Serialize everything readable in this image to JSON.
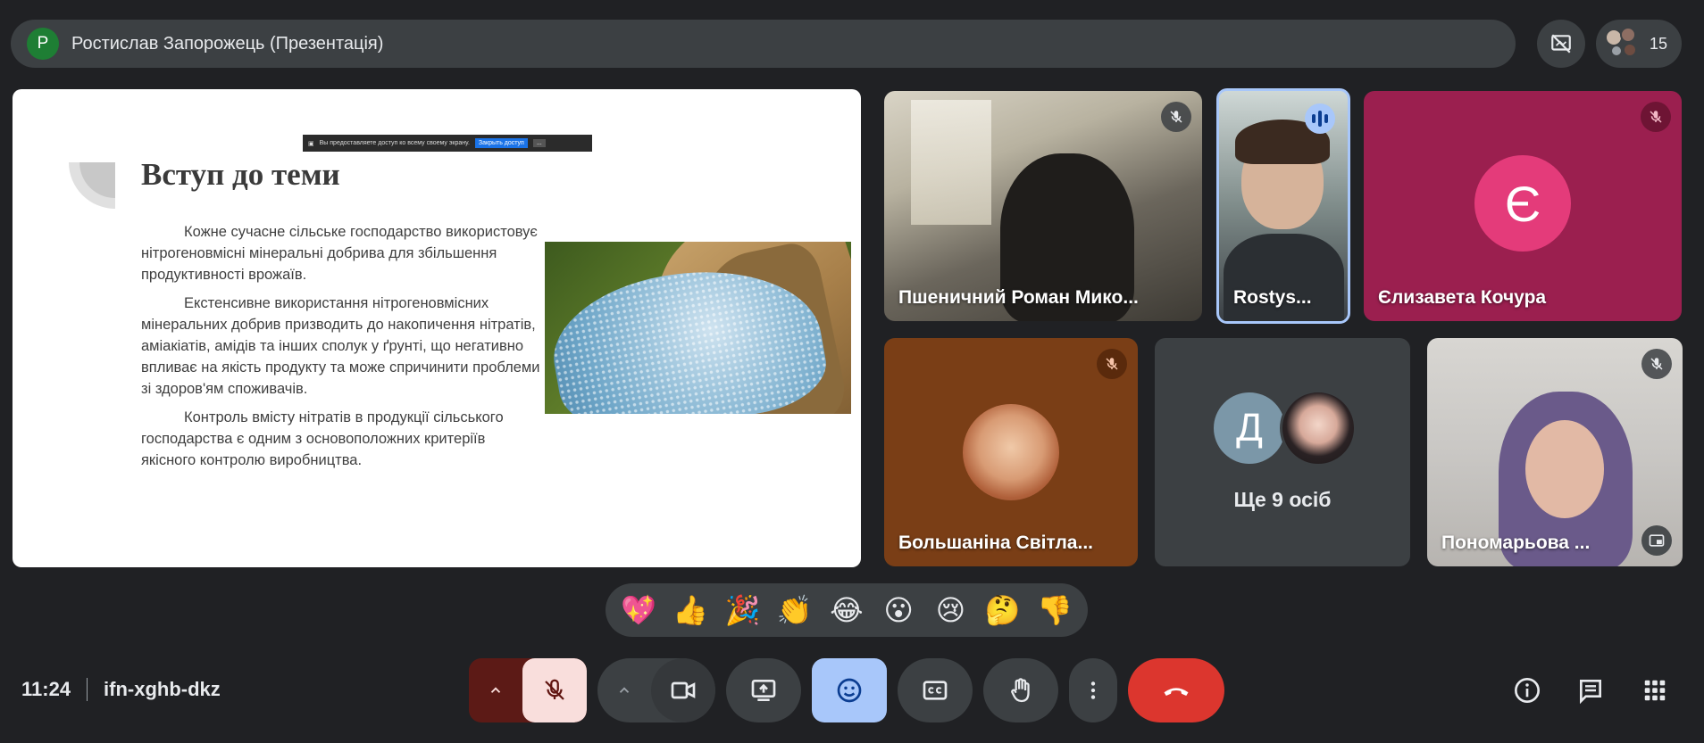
{
  "header": {
    "presenter_initial": "Р",
    "presenter_title": "Ростислав Запорожець (Презентація)",
    "participant_count": "15"
  },
  "slide": {
    "title": "Вступ до теми",
    "paragraphs": [
      "Кожне сучасне сільське господарство використовує нітрогеновмісні мінеральні добрива для збільшення продуктивності врожаїв.",
      "Екстенсивне використання нітрогеновмісних мінеральних добрив призводить до накопичення нітратів, аміакіатів, амідів та інших сполук у ґрунті, що негативно впливає на якість продукту та може спричинити проблеми зі здоров'ям споживачів.",
      "Контроль вмісту нітратів в продукції сільського господарства є одним з основоположних критеріїв якісного контролю виробництва."
    ],
    "share_banner": {
      "text": "Вы предоставляете доступ ко всему своему экрану.",
      "button": "Закрыть доступ",
      "more": "..."
    }
  },
  "participants": [
    {
      "name": "Пшеничний Роман Мико...",
      "muted": true
    },
    {
      "name": "Rostys...",
      "speaking": true
    },
    {
      "name": "Єлизавета Кочура",
      "initial": "Є",
      "muted": true
    },
    {
      "name": "Большаніна Світла...",
      "muted": true
    },
    {
      "name": "Ще 9 осіб",
      "initial": "Д"
    },
    {
      "name": "Пономарьова ...",
      "muted": true
    }
  ],
  "reactions": [
    "💖",
    "👍",
    "🎉",
    "👏",
    "😂",
    "😮",
    "😢",
    "🤔",
    "👎"
  ],
  "footer": {
    "time": "11:24",
    "meeting_code": "ifn-xghb-dkz"
  },
  "colors": {
    "background": "#202124",
    "surface": "#3c4043",
    "accent": "#a8c7fa",
    "leave": "#dc362e",
    "mic_off_bg": "#f9dedc"
  }
}
